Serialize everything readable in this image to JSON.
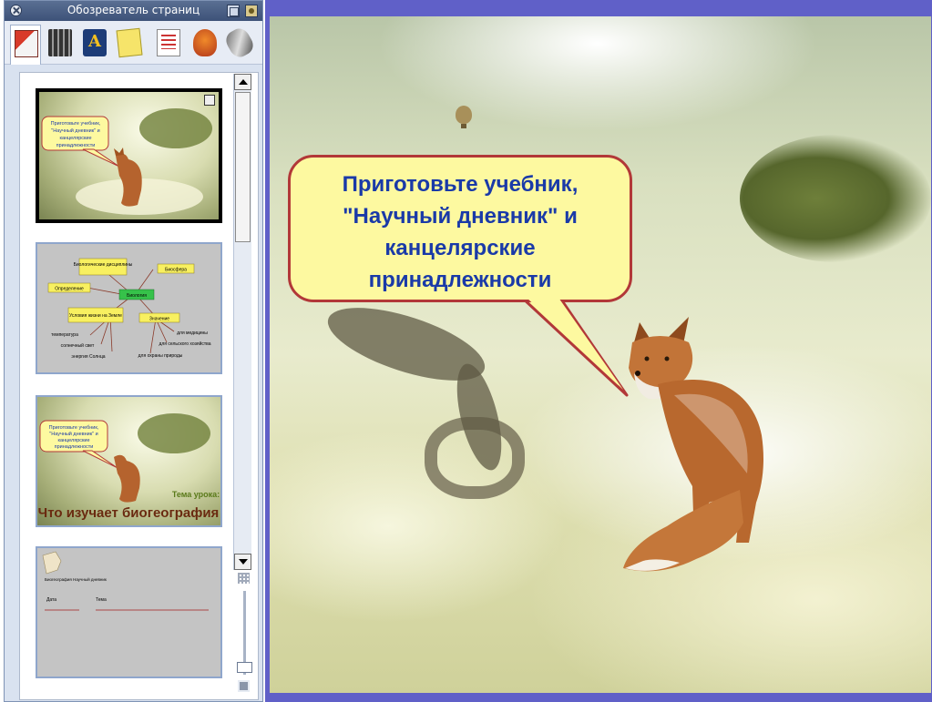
{
  "window": {
    "title": "Обозреватель страниц"
  },
  "toolbar": {
    "tools": [
      {
        "icon": "page-sorter-icon",
        "active": true
      },
      {
        "icon": "media-icon",
        "active": false
      },
      {
        "icon": "gallery-icon",
        "active": false
      },
      {
        "icon": "notes-icon",
        "active": false
      },
      {
        "icon": "properties-icon",
        "active": false
      },
      {
        "icon": "spinning-top-icon",
        "active": false
      },
      {
        "icon": "pen-tools-icon",
        "active": false
      }
    ]
  },
  "pages": {
    "thumbnails": [
      {
        "kind": "fox-scene",
        "selected": true,
        "lines": [
          "Приготовьте учебник,",
          "\"Научный дневник\" и",
          "канцелярские",
          "принадлежности"
        ]
      },
      {
        "kind": "mind-map",
        "selected": false,
        "nodes": [
          "Биологические дисциплины",
          "Биосфера",
          "Определение",
          "Биология",
          "Условия жизни на Земле",
          "Значение",
          "температура",
          "солнечный свет",
          "энергия Солнца",
          "для медицины",
          "для сельского хозяйства",
          "для охраны природы"
        ]
      },
      {
        "kind": "fox-lesson",
        "selected": false,
        "caption_small": "Тема урока:",
        "caption_large": "Что изучает биогеография",
        "lines": [
          "Приготовьте учебник,",
          "\"Научный дневник\" и",
          "канцелярские",
          "принадлежности"
        ]
      },
      {
        "kind": "diary-form",
        "selected": false,
        "heading": "Биогеография Научный дневник",
        "field1": "Дата",
        "field2": "Тема"
      }
    ]
  },
  "slide": {
    "callout": "Приготовьте учебник, \"Научный дневник\" и канцелярские принадлежности",
    "callout_lines": [
      "Приготовьте учебник,",
      "\"Научный дневник\" и",
      "канцелярские",
      "принадлежности"
    ],
    "colors": {
      "callout_fill": "#fdf9a0",
      "callout_border": "#b23838",
      "callout_text": "#1a3aa8",
      "frame": "#6060c8"
    }
  }
}
